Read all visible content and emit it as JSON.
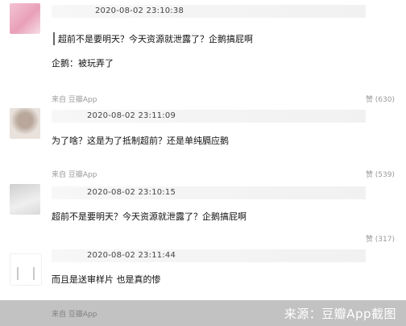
{
  "comments": [
    {
      "timestamp": "2020-08-02 23:10:38",
      "quote": "超前不是要明天？今天资源就泄露了？企鹅搞屁啊",
      "text": "企鹅：被玩弄了",
      "source": "来自 豆瓣App",
      "likes": "赞 (630)"
    },
    {
      "timestamp": "2020-08-02 23:11:09",
      "text": "为了啥？这是为了抵制超前？还是单纯膈应鹅",
      "source": "来自 豆瓣App",
      "likes": "赞 (539)"
    },
    {
      "timestamp": "2020-08-02 23:10:15",
      "text": "超前不是要明天？今天资源就泄露了？企鹅搞屁啊",
      "likes": "赞 (317)"
    },
    {
      "timestamp": "2020-08-02 23:11:44",
      "text": "而且是送审样片 也是真的惨",
      "source": "来自 豆瓣App"
    }
  ],
  "watermark": "来源：豆瓣App截图"
}
